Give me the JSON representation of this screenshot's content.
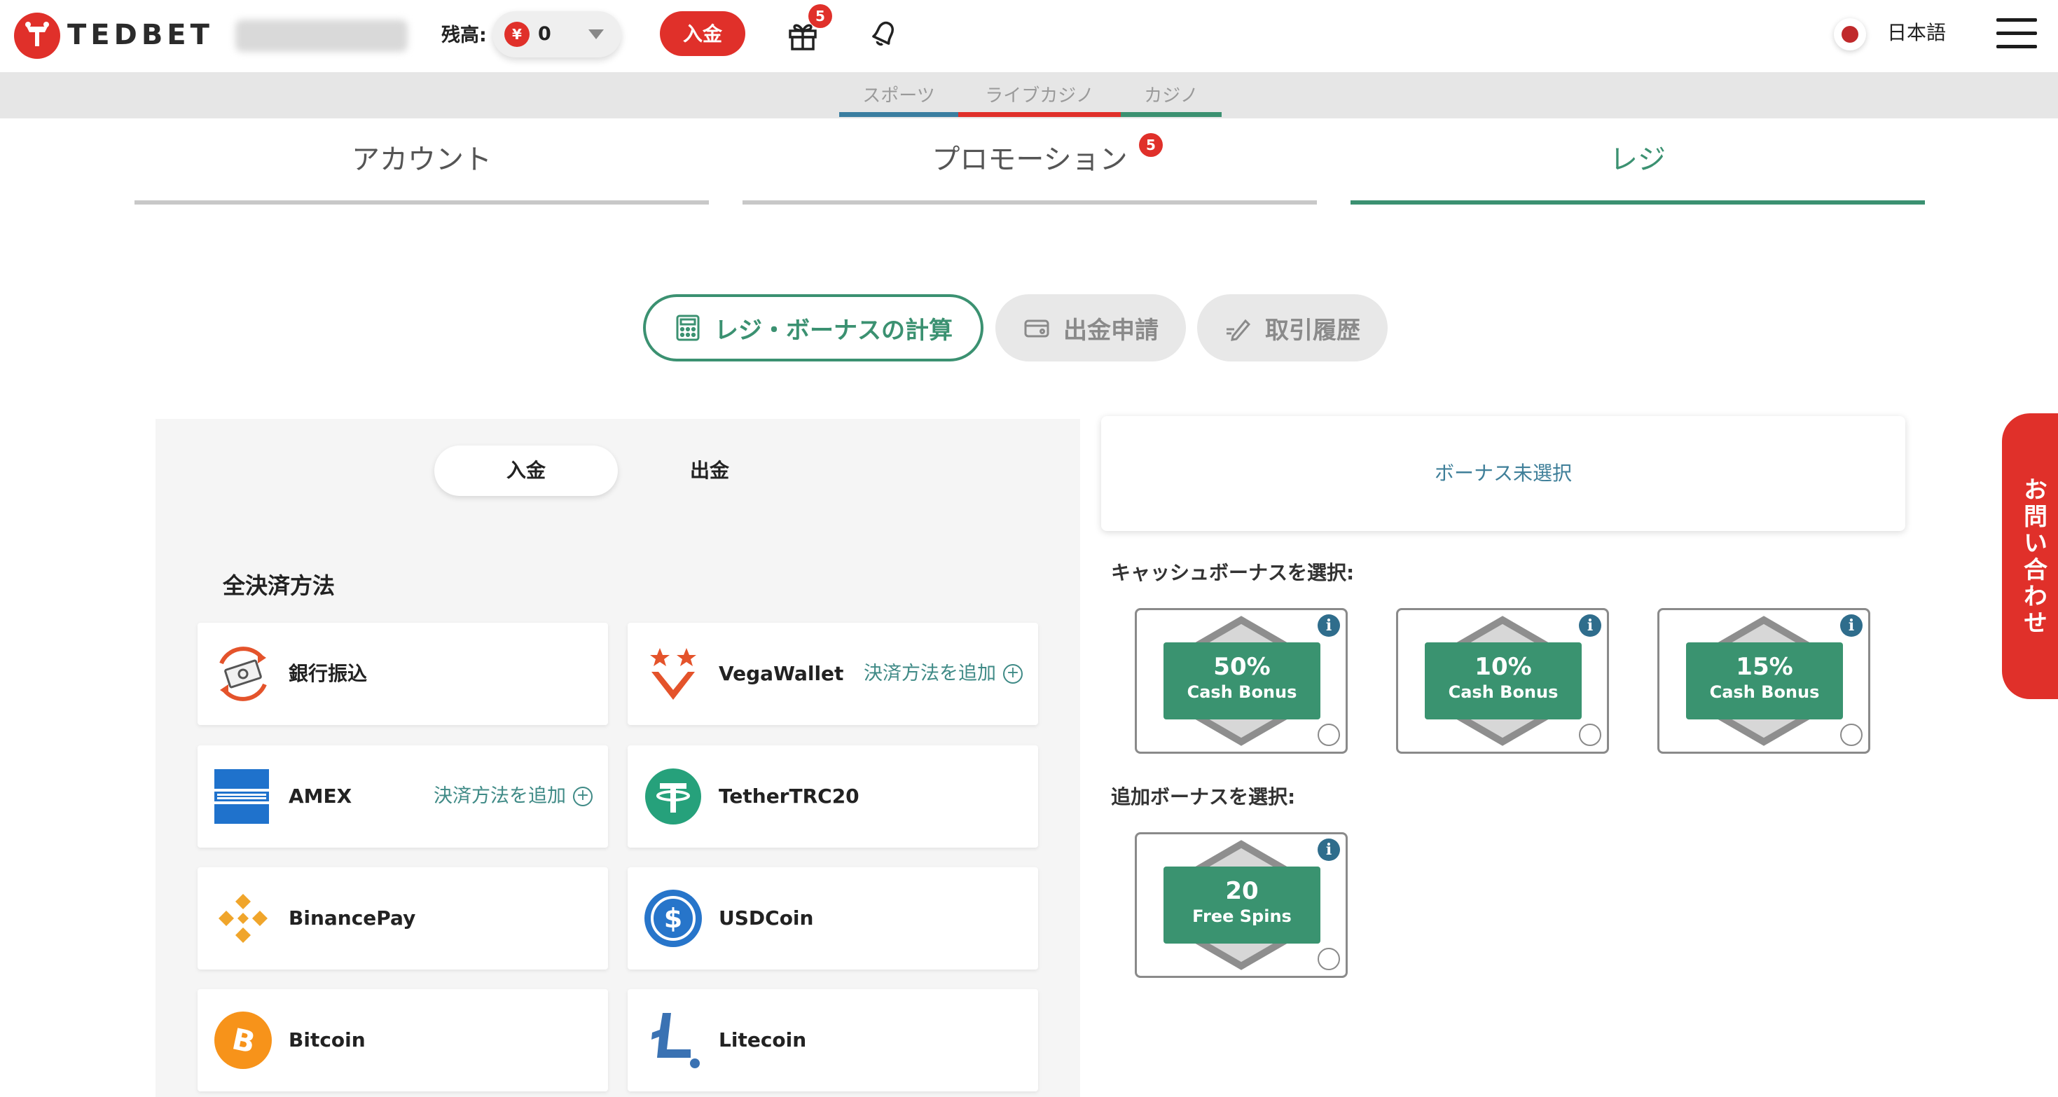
{
  "header": {
    "brand": "TEDBET",
    "balance_label": "残高:",
    "currency_symbol": "¥",
    "balance_value": "0",
    "deposit_button": "入金",
    "gift_badge": "5",
    "language": "日本語"
  },
  "categories": [
    {
      "label": "スポーツ",
      "color": "#3a7ea0"
    },
    {
      "label": "ライブカジノ",
      "color": "#e0302a"
    },
    {
      "label": "カジノ",
      "color": "#3b9171"
    }
  ],
  "main_tabs": [
    {
      "label": "アカウント",
      "active": false
    },
    {
      "label": "プロモーション",
      "active": false,
      "badge": "5"
    },
    {
      "label": "レジ",
      "active": true
    }
  ],
  "cashier_tabs": {
    "calc": "レジ・ボーナスの計算",
    "withdraw": "出金申請",
    "history": "取引履歴"
  },
  "payments": {
    "toggle_deposit": "入金",
    "toggle_withdraw": "出金",
    "title": "全決済方法",
    "add_label": "決済方法を追加",
    "methods": [
      {
        "name": "銀行振込",
        "icon": "bank-transfer-icon",
        "add": false
      },
      {
        "name": "VegaWallet",
        "icon": "vegawallet-icon",
        "add": true
      },
      {
        "name": "AMEX",
        "icon": "amex-icon",
        "add": true
      },
      {
        "name": "TetherTRC20",
        "icon": "tether-icon",
        "add": false
      },
      {
        "name": "BinancePay",
        "icon": "binance-icon",
        "add": false
      },
      {
        "name": "USDCoin",
        "icon": "usdcoin-icon",
        "add": false
      },
      {
        "name": "Bitcoin",
        "icon": "bitcoin-icon",
        "add": false
      },
      {
        "name": "Litecoin",
        "icon": "litecoin-icon",
        "add": false
      }
    ]
  },
  "bonus": {
    "none_selected": "ボーナス未選択",
    "cash_label": "キャッシュボーナスを選択:",
    "extra_label": "追加ボーナスを選択:",
    "cash_bonuses": [
      {
        "value": "50%",
        "label": "Cash Bonus"
      },
      {
        "value": "10%",
        "label": "Cash Bonus"
      },
      {
        "value": "15%",
        "label": "Cash Bonus"
      }
    ],
    "extra_bonuses": [
      {
        "value": "20",
        "label": "Free Spins"
      }
    ],
    "info_glyph": "i"
  },
  "contact": "お問い合わせ",
  "colors": {
    "brand_red": "#e0302a",
    "accent_green": "#3b9171",
    "link_teal": "#3f8a86",
    "info_blue": "#2f6d8c"
  }
}
